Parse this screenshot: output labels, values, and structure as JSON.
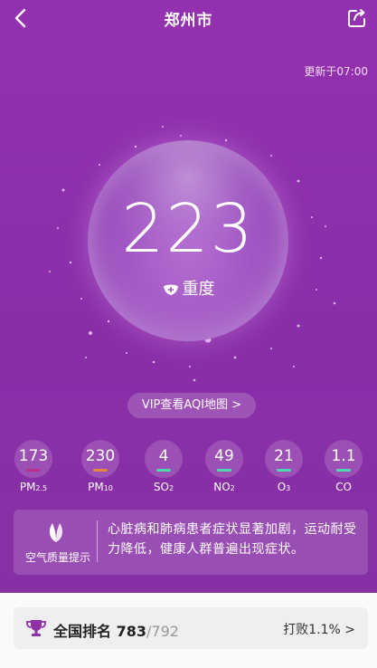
{
  "header": {
    "city": "郑州市"
  },
  "updated": "更新于07:00",
  "aqi": {
    "value": "223",
    "level": "重度"
  },
  "vip_button": "VIP查看AQI地图 >",
  "pollutants": [
    {
      "value": "173",
      "name": "PM",
      "sub": "2.5",
      "color": "#b8328c"
    },
    {
      "value": "230",
      "name": "PM",
      "sub": "10",
      "color": "#e4873a"
    },
    {
      "value": "4",
      "name": "SO",
      "sub": "2",
      "color": "#4fd6b2"
    },
    {
      "value": "49",
      "name": "NO",
      "sub": "2",
      "color": "#4fd6b2"
    },
    {
      "value": "21",
      "name": "O",
      "sub": "3",
      "color": "#4fd6b2"
    },
    {
      "value": "1.1",
      "name": "CO",
      "sub": "",
      "color": "#4fd6b2"
    }
  ],
  "tip": {
    "label": "空气质量提示",
    "text": "心脏病和肺病患者症状显著加剧，运动耐受力降低，健康人群普遍出现症状。"
  },
  "ranking": {
    "label": "全国排名",
    "rank": "783",
    "total": "/792",
    "beat": "打败1.1% >"
  }
}
